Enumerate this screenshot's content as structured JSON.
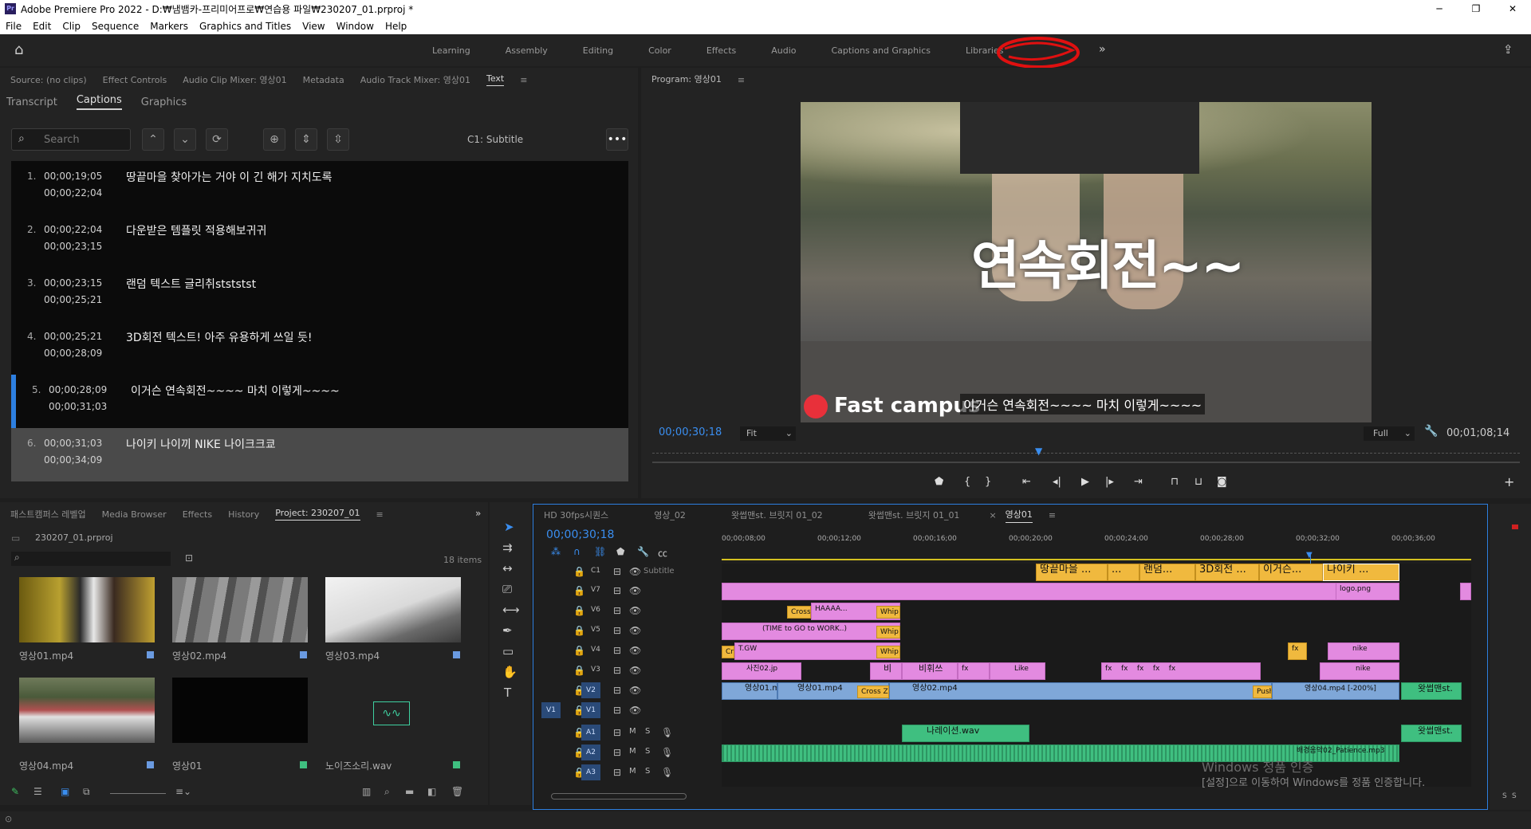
{
  "title": "Adobe Premiere Pro 2022 - D:₩냄뱀카-프리미어프로₩연습용 파일₩230207_01.prproj *",
  "app_icon": "Pr",
  "menu": [
    "File",
    "Edit",
    "Clip",
    "Sequence",
    "Markers",
    "Graphics and Titles",
    "View",
    "Window",
    "Help"
  ],
  "workspaces": [
    "Learning",
    "Assembly",
    "Editing",
    "Color",
    "Effects",
    "Audio",
    "Captions and Graphics",
    "Libraries"
  ],
  "source_tabs": [
    "Source: (no clips)",
    "Effect Controls",
    "Audio Clip Mixer: 영상01",
    "Metadata",
    "Audio Track Mixer: 영상01",
    "Text"
  ],
  "text_subtabs": [
    "Transcript",
    "Captions",
    "Graphics"
  ],
  "search_placeholder": "Search",
  "caption_track": "C1: Subtitle",
  "captions": [
    {
      "n": "1.",
      "in": "00;00;19;05",
      "out": "00;00;22;04",
      "text": "땅끝마을 찾아가는 거야 이 긴 해가 지치도록"
    },
    {
      "n": "2.",
      "in": "00;00;22;04",
      "out": "00;00;23;15",
      "text": "다운받은 템플릿 적용해보귀귀"
    },
    {
      "n": "3.",
      "in": "00;00;23;15",
      "out": "00;00;25;21",
      "text": "랜덤 텍스트 글리취stststst"
    },
    {
      "n": "4.",
      "in": "00;00;25;21",
      "out": "00;00;28;09",
      "text": "3D회전 텍스트! 아주 유용하게 쓰일 듯!"
    },
    {
      "n": "5.",
      "in": "00;00;28;09",
      "out": "00;00;31;03",
      "text": "이거슨 연속회전~~~~ 마치 이렇게~~~~"
    },
    {
      "n": "6.",
      "in": "00;00;31;03",
      "out": "00;00;34;09",
      "text": "나이키 나이끼 NIKE 나이크크쿄"
    }
  ],
  "program": {
    "tab": "Program: 영상01",
    "overlay": "연속회전~~",
    "brand": "Fast campus",
    "subtitle": "이거슨 연속회전~~~~ 마치 이렇게~~~~",
    "timecode": "00;00;30;18",
    "fit": "Fit",
    "quality": "Full",
    "duration": "00;01;08;14"
  },
  "project_tabs": [
    "패스트캠퍼스 레벨업",
    "Media Browser",
    "Effects",
    "History",
    "Project: 230207_01"
  ],
  "project_file": "230207_01.prproj",
  "items_count": "18 items",
  "media": [
    "영상01.mp4",
    "영상02.mp4",
    "영상03.mp4",
    "영상04.mp4",
    "영상01",
    "노이즈소리.wav"
  ],
  "seq_tabs": [
    "HD 30fps시퀀스",
    "영상_02",
    "왓썹맨st. 브릿지 01_02",
    "왓썹맨st. 브릿지 01_01",
    "영상01"
  ],
  "seq_timecode": "00;00;30;18",
  "ruler": [
    "00;00;08;00",
    "00;00;12;00",
    "00;00;16;00",
    "00;00;20;00",
    "00;00;24;00",
    "00;00;28;00",
    "00;00;32;00",
    "00;00;36;00"
  ],
  "tracks_video": [
    "C1",
    "V7",
    "V6",
    "V5",
    "V4",
    "V3",
    "V2",
    "V1"
  ],
  "tracks_audio": [
    "A1",
    "A2",
    "A3"
  ],
  "subtitle_label": "Subtitle",
  "caption_clips": [
    "땅끝마을 ...",
    "...",
    "랜덤...",
    "3D회전 ...",
    "이거슨...",
    "나이키 ..."
  ],
  "clips": {
    "v7_logo": "logo.png",
    "v5_cross": "Cross",
    "v5_haaaa": "HAAAA...",
    "whip": "Whip",
    "v4_time": "(TIME to GO to WORK..)",
    "v3_tgw": "T.GW",
    "v3_cr": "Cr",
    "v3_nike": "nike",
    "v2_photo": "사진02.jp",
    "v2_bi": "비",
    "v2_bihwi": "비휘쓰",
    "v2_like": "Like",
    "v2_nike": "nike",
    "v1_a": "영상01.m",
    "v1_b": "영상01.mp4",
    "v1_cross": "Cross Zoo",
    "v1_c": "영상02.mp4",
    "v1_push": "Push",
    "v1_d": "영상04.mp4 [-200%]",
    "v1_e": "왓썹맨st.",
    "a1_narr": "나레이션.wav",
    "a1_e": "왓썹맨st.",
    "a2_bgm": "배경음악02_Patience.mp3"
  },
  "watermark1": "Windows 정품 인증",
  "watermark2": "[설정]으로 이동하여 Windows를 정품 인증합니다.",
  "meter_labels": [
    "S",
    "S"
  ]
}
